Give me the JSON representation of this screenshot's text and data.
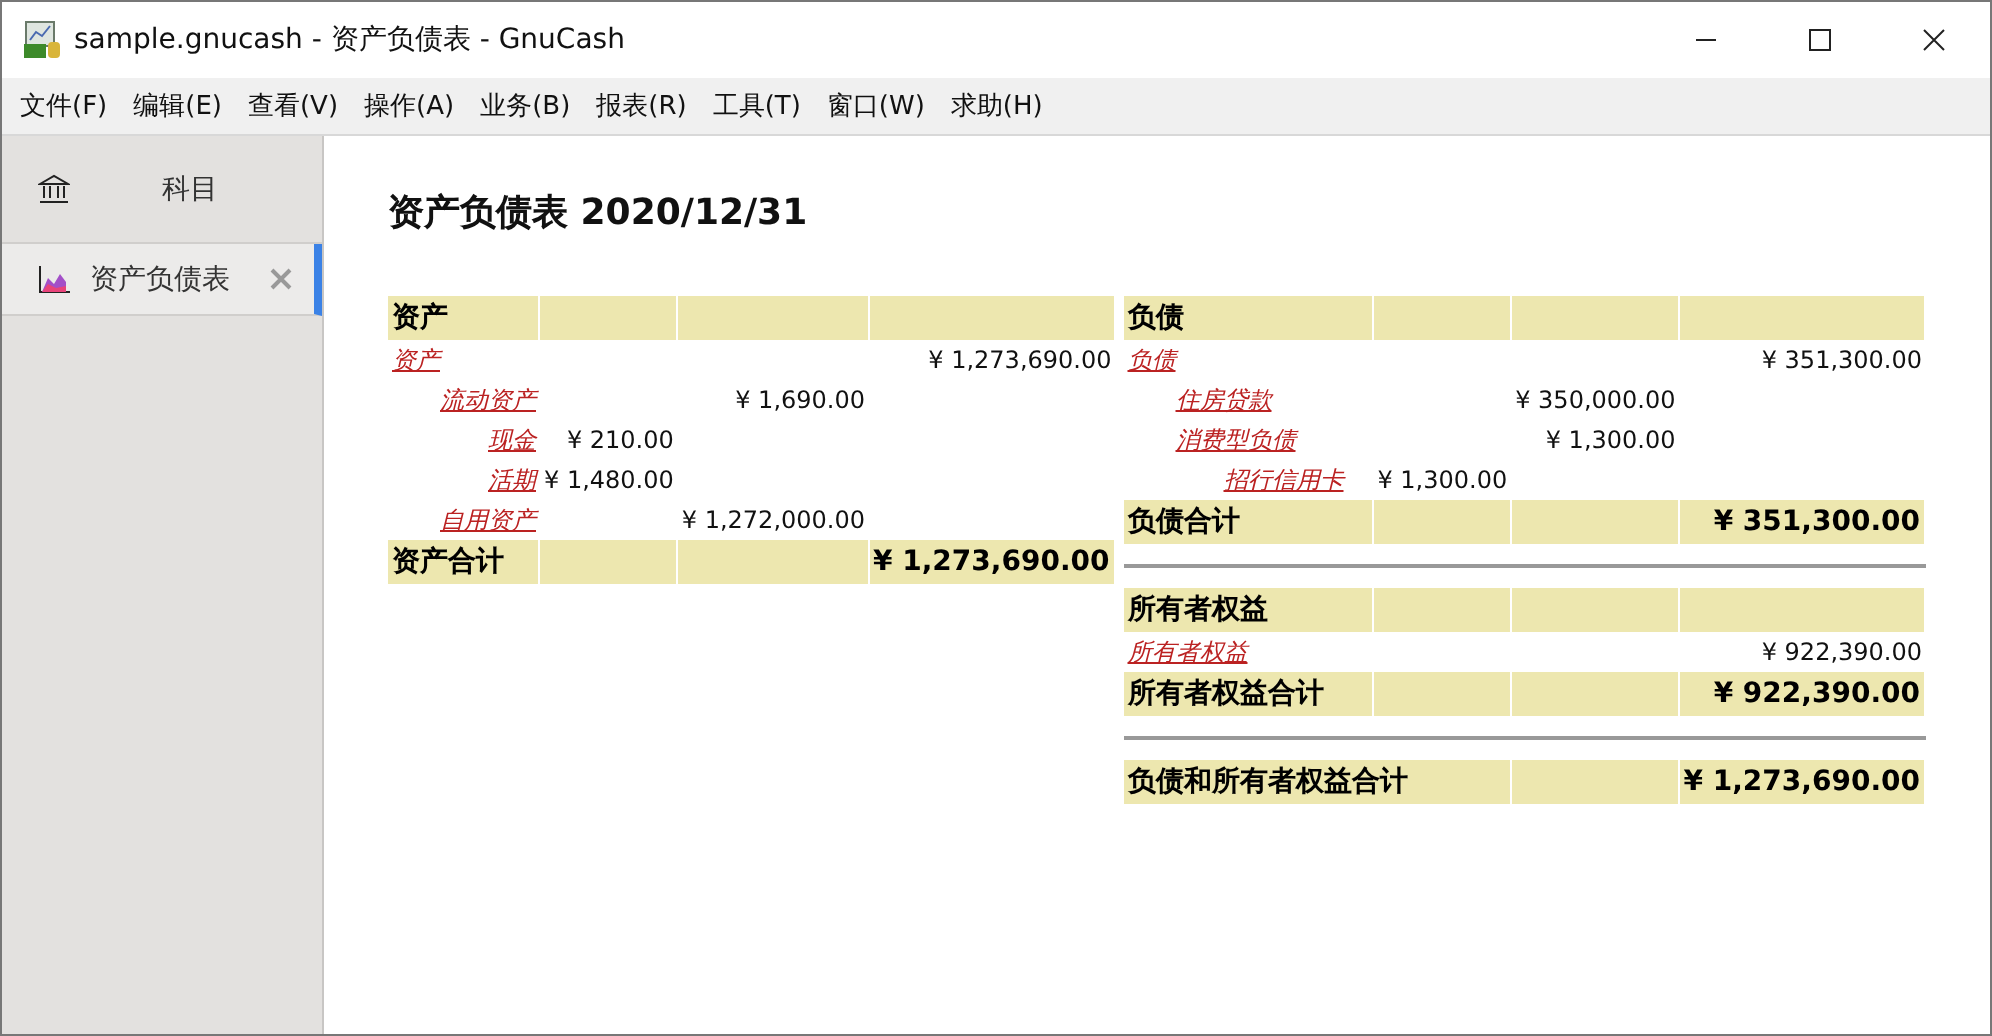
{
  "window": {
    "title": "sample.gnucash - 资产负债表 - GnuCash"
  },
  "menu": [
    "文件(F)",
    "编辑(E)",
    "查看(V)",
    "操作(A)",
    "业务(B)",
    "报表(R)",
    "工具(T)",
    "窗口(W)",
    "求助(H)"
  ],
  "sidebar": {
    "tabs": [
      {
        "kind": "accounts",
        "label": "科目",
        "selected": false
      },
      {
        "kind": "report",
        "label": "资产负债表",
        "selected": true
      }
    ]
  },
  "report": {
    "title": "资产负债表 2020/12/31",
    "left": [
      {
        "kind": "header",
        "label": "资产"
      },
      {
        "kind": "accounts",
        "accounts": [
          {
            "name": "资产",
            "amount": "¥ 1,273,690.00",
            "children": [
              {
                "name": "流动资产",
                "amount": "¥ 1,690.00",
                "children": [
                  {
                    "name": "现金",
                    "amount": "¥ 210.00"
                  },
                  {
                    "name": "活期",
                    "amount": "¥ 1,480.00"
                  }
                ]
              },
              {
                "name": "自用资产",
                "amount": "¥ 1,272,000.00"
              }
            ]
          }
        ]
      },
      {
        "kind": "total",
        "label": "资产合计",
        "amount": "¥ 1,273,690.00"
      }
    ],
    "right": [
      {
        "kind": "header",
        "label": "负债"
      },
      {
        "kind": "accounts",
        "accounts": [
          {
            "name": "负债",
            "amount": "¥ 351,300.00",
            "children": [
              {
                "name": "住房贷款",
                "amount": "¥ 350,000.00"
              },
              {
                "name": "消费型负债",
                "amount": "¥ 1,300.00",
                "children": [
                  {
                    "name": "招行信用卡",
                    "amount": "¥ 1,300.00"
                  }
                ]
              }
            ]
          }
        ]
      },
      {
        "kind": "total",
        "label": "负债合计",
        "amount": "¥ 351,300.00"
      },
      {
        "kind": "rule"
      },
      {
        "kind": "header",
        "label": "所有者权益"
      },
      {
        "kind": "accounts",
        "accounts": [
          {
            "name": "所有者权益",
            "amount": "¥ 922,390.00"
          }
        ]
      },
      {
        "kind": "total",
        "label": "所有者权益合计",
        "amount": "¥ 922,390.00"
      },
      {
        "kind": "rule"
      },
      {
        "kind": "grand_total",
        "label": "负债和所有者权益合计",
        "amount": "¥ 1,273,690.00"
      }
    ]
  }
}
